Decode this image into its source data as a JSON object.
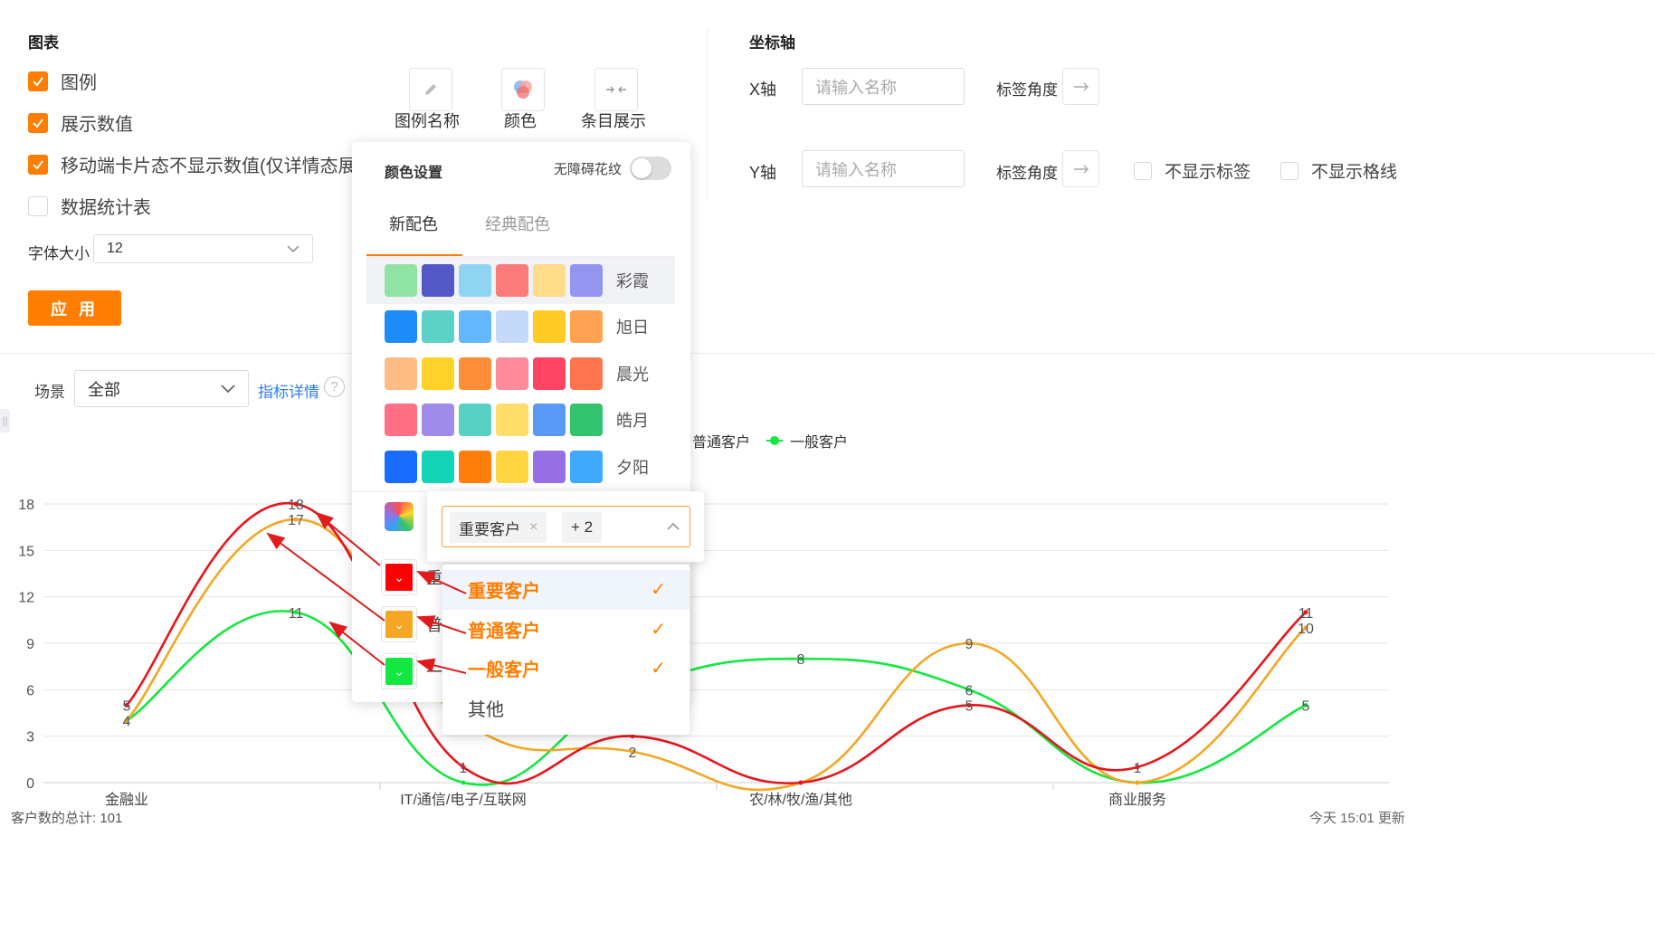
{
  "chart_settings": {
    "title": "图表",
    "options": [
      {
        "label": "图例",
        "checked": true
      },
      {
        "label": "展示数值",
        "checked": true
      },
      {
        "label": "移动端卡片态不显示数值(仅详情态展示)",
        "checked": true
      },
      {
        "label": "数据统计表",
        "checked": false
      }
    ],
    "font_size_label": "字体大小",
    "font_size_value": "12",
    "apply_label": "应 用",
    "tools": [
      {
        "label": "图例名称",
        "icon": "pencil-icon"
      },
      {
        "label": "颜色",
        "icon": "color-circles-icon"
      },
      {
        "label": "条目展示",
        "icon": "arrows-in-icon"
      }
    ]
  },
  "axis_settings": {
    "title": "坐标轴",
    "x_label": "X轴",
    "y_label": "Y轴",
    "x_placeholder": "请输入名称",
    "y_placeholder": "请输入名称",
    "angle_label": "标签角度",
    "hide_labels": "不显示标签",
    "hide_grid": "不显示格线"
  },
  "color_popover": {
    "title": "颜色设置",
    "accessibility_label": "无障碍花纹",
    "tabs": [
      "新配色",
      "经典配色"
    ],
    "active_tab": 0,
    "palettes": [
      {
        "name": "彩霞",
        "colors": [
          "#8fe3a3",
          "#5358c7",
          "#8fd5f2",
          "#fb7a7a",
          "#fedc8a",
          "#9395ef"
        ]
      },
      {
        "name": "旭日",
        "colors": [
          "#1d8cf8",
          "#5cd1c6",
          "#63b8ff",
          "#c5d9fb",
          "#ffcc26",
          "#ffa352"
        ]
      },
      {
        "name": "晨光",
        "colors": [
          "#ffbd85",
          "#ffd229",
          "#ff8d38",
          "#ff8a9b",
          "#ff4466",
          "#ff7550"
        ]
      },
      {
        "name": "皓月",
        "colors": [
          "#ff7087",
          "#9f8cea",
          "#58d1c4",
          "#ffdd6b",
          "#5a98f6",
          "#32c46e"
        ]
      },
      {
        "name": "夕阳",
        "colors": [
          "#1a6cfe",
          "#13d4b4",
          "#ff7d0a",
          "#ffd641",
          "#9670e3",
          "#3ea9fd"
        ]
      }
    ],
    "series_colors": [
      {
        "label": "重",
        "color": "#ff0000"
      },
      {
        "label": "普",
        "color": "#f5a623"
      },
      {
        "label": "一",
        "color": "#12e83f"
      }
    ]
  },
  "series_select": {
    "tag": "重要客户",
    "more": "+ 2",
    "options": [
      {
        "label": "重要客户",
        "selected": true
      },
      {
        "label": "普通客户",
        "selected": true
      },
      {
        "label": "一般客户",
        "selected": true
      },
      {
        "label": "其他",
        "selected": false
      }
    ]
  },
  "filter": {
    "scene_label": "场景",
    "scene_value": "全部",
    "detail_link": "指标详情",
    "help_icon": "?"
  },
  "legend_visible": [
    {
      "name": "普通客户",
      "color": "#f5a623"
    },
    {
      "name": "一般客户",
      "color": "#12e83f"
    }
  ],
  "footer_left": "客户数的总计: 101",
  "footer_right": "今天 15:01 更新",
  "chart_data": {
    "type": "line",
    "categories": [
      "金融业",
      "",
      "IT/通信/电子/互联网",
      "",
      "农/林/牧/渔/其他",
      "",
      "商业服务",
      ""
    ],
    "ylim": [
      0,
      18
    ],
    "yticks": [
      0,
      3,
      6,
      9,
      12,
      15,
      18
    ],
    "grid": true,
    "series": [
      {
        "name": "重要客户",
        "color": "#e8151b",
        "values": [
          5,
          18,
          1,
          3,
          0,
          5,
          1,
          11
        ]
      },
      {
        "name": "普通客户",
        "color": "#f5a623",
        "values": [
          4,
          17,
          4,
          2,
          0,
          9,
          0,
          10
        ]
      },
      {
        "name": "一般客户",
        "color": "#12e83f",
        "values": [
          4,
          11,
          0,
          6,
          8,
          6,
          0,
          5
        ]
      }
    ],
    "labels": [
      {
        "series": 0,
        "points": [
          0,
          1,
          2,
          5,
          6,
          7
        ]
      },
      {
        "series": 1,
        "points": [
          1,
          3,
          5,
          7
        ]
      },
      {
        "series": 2,
        "points": [
          0,
          1,
          4,
          5,
          7
        ]
      }
    ]
  }
}
